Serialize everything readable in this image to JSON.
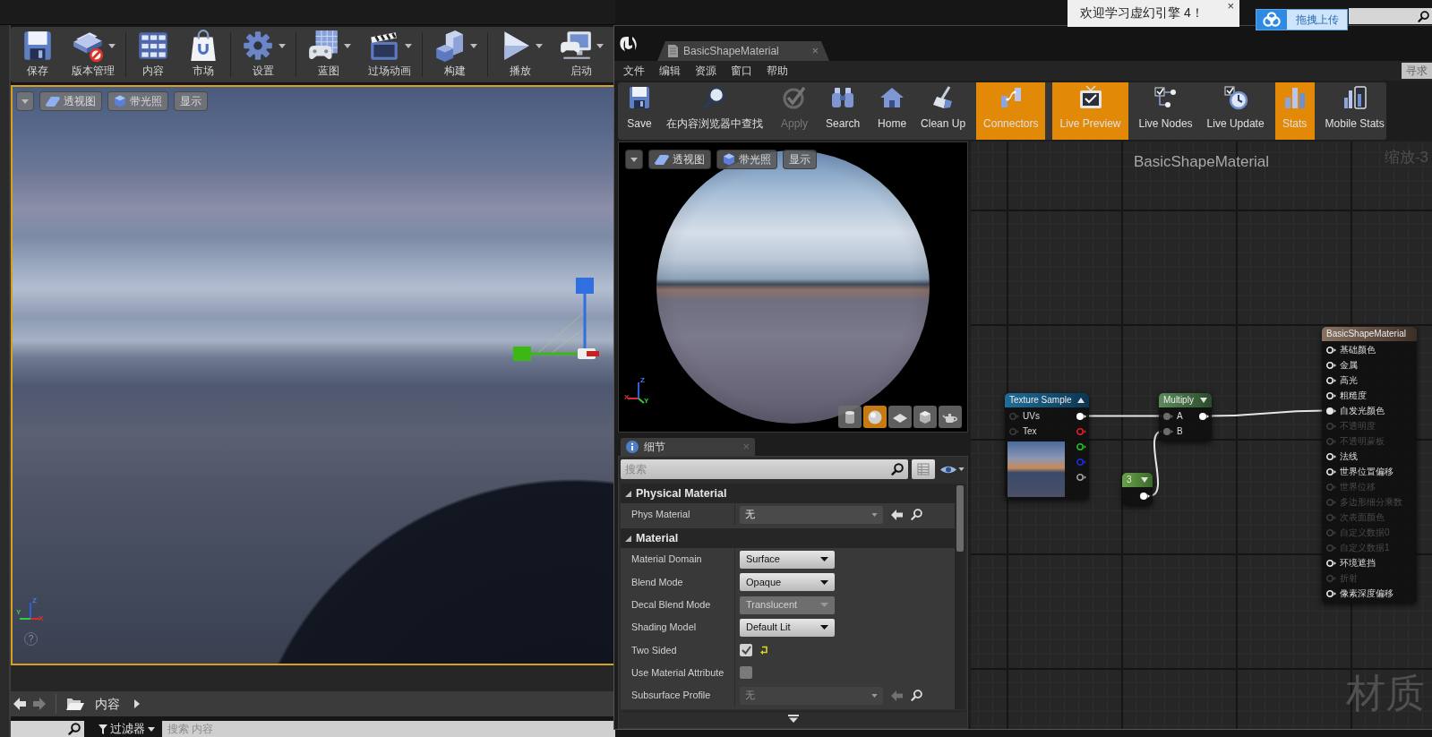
{
  "editor": {
    "toolbar": [
      {
        "label": "保存",
        "dropdown": false
      },
      {
        "label": "版本管理",
        "dropdown": true
      },
      {
        "label": "内容",
        "dropdown": false
      },
      {
        "label": "市场",
        "dropdown": false
      },
      {
        "label": "设置",
        "dropdown": true
      },
      {
        "label": "蓝图",
        "dropdown": true
      },
      {
        "label": "过场动画",
        "dropdown": true
      },
      {
        "label": "构建",
        "dropdown": true
      },
      {
        "label": "播放",
        "dropdown": true
      },
      {
        "label": "启动",
        "dropdown": true
      }
    ],
    "viewport": {
      "view_mode": "透视图",
      "lighting": "带光照",
      "show": "显示",
      "axes": [
        "Z",
        "Y",
        "X"
      ],
      "help": "?"
    }
  },
  "content_browser": {
    "path": "内容",
    "filter": "过滤器",
    "search": {
      "placeholder": "搜索 内容"
    }
  },
  "notification": {
    "text": "欢迎学习虚幻引擎 4！",
    "close": "×"
  },
  "upload_button": {
    "label": "拖拽上传"
  },
  "material_editor": {
    "tab": {
      "title": "BasicShapeMaterial",
      "close": "×"
    },
    "menu": [
      "文件",
      "编辑",
      "资源",
      "窗口",
      "帮助"
    ],
    "help_search": {
      "placeholder": "寻求"
    },
    "toolbar": [
      {
        "label": "Save",
        "on": false,
        "disabled": false
      },
      {
        "label": "在内容浏览器中查找",
        "on": false,
        "disabled": false
      },
      {
        "label": "Apply",
        "on": false,
        "disabled": true
      },
      {
        "label": "Search",
        "on": false,
        "disabled": false
      },
      {
        "label": "Home",
        "on": false,
        "disabled": false
      },
      {
        "label": "Clean Up",
        "on": false,
        "disabled": false
      },
      {
        "label": "Connectors",
        "on": true,
        "disabled": false
      },
      {
        "label": "Live Preview",
        "on": true,
        "disabled": false
      },
      {
        "label": "Live Nodes",
        "on": false,
        "disabled": false
      },
      {
        "label": "Live Update",
        "on": false,
        "disabled": false
      },
      {
        "label": "Stats",
        "on": true,
        "disabled": false
      },
      {
        "label": "Mobile Stats",
        "on": false,
        "disabled": false
      }
    ],
    "preview": {
      "view_mode": "透视图",
      "lighting": "带光照",
      "show": "显示",
      "axes": [
        "Z",
        "X",
        "Y"
      ],
      "shapes": [
        {
          "selected": false
        },
        {
          "selected": true
        },
        {
          "selected": false
        },
        {
          "selected": false
        },
        {
          "selected": false
        }
      ]
    },
    "details": {
      "tab": "细节",
      "close": "×",
      "search": {
        "placeholder": "搜索"
      },
      "sections": [
        {
          "title": "Physical Material",
          "expanded": true,
          "rows": [
            {
              "kind": "asset",
              "label": "Phys Material",
              "value": "无",
              "disabled": false
            }
          ]
        },
        {
          "title": "Material",
          "expanded": true,
          "rows": [
            {
              "kind": "combo",
              "label": "Material Domain",
              "value": "Surface",
              "disabled": false
            },
            {
              "kind": "combo",
              "label": "Blend Mode",
              "value": "Opaque",
              "disabled": false
            },
            {
              "kind": "combo",
              "label": "Decal Blend Mode",
              "value": "Translucent",
              "disabled": true
            },
            {
              "kind": "combo",
              "label": "Shading Model",
              "value": "Default Lit",
              "disabled": false
            },
            {
              "kind": "checkbox",
              "label": "Two Sided",
              "checked": true,
              "modified": true
            },
            {
              "kind": "checkbox",
              "label": "Use Material Attribute",
              "checked": false,
              "modified": false
            },
            {
              "kind": "asset",
              "label": "Subsurface Profile",
              "value": "无",
              "disabled": true
            }
          ]
        }
      ]
    },
    "graph": {
      "title": "BasicShapeMaterial",
      "zoom": "缩放-3",
      "type_label": "材质",
      "nodes": [
        {
          "kind": "texture_sample",
          "title": "Texture Sample",
          "inputs": [
            {
              "label": "UVs",
              "connected": false
            },
            {
              "label": "Tex",
              "connected": false
            }
          ],
          "outputs": [
            {
              "color": "#ffffff",
              "connected": true
            },
            {
              "color": "#e02020",
              "connected": false
            },
            {
              "color": "#20c020",
              "connected": false
            },
            {
              "color": "#1c2ce0",
              "connected": false
            },
            {
              "color": "#a0a0a0",
              "connected": false
            }
          ]
        },
        {
          "kind": "multiply",
          "title": "Multiply",
          "inputs": [
            {
              "label": "A",
              "connected": true
            },
            {
              "label": "B",
              "connected": true
            }
          ],
          "outputs": [
            {
              "color": "#ffffff",
              "connected": true
            }
          ]
        },
        {
          "kind": "constant",
          "title": "3",
          "outputs": [
            {
              "color": "#ffffff",
              "connected": true
            }
          ]
        },
        {
          "kind": "result",
          "title": "BasicShapeMaterial",
          "inputs": [
            {
              "label": "基础颜色",
              "enabled": true,
              "connected": false
            },
            {
              "label": "金属",
              "enabled": true,
              "connected": false
            },
            {
              "label": "高光",
              "enabled": true,
              "connected": false
            },
            {
              "label": "粗糙度",
              "enabled": true,
              "connected": false
            },
            {
              "label": "自发光颜色",
              "enabled": true,
              "connected": true
            },
            {
              "label": "不透明度",
              "enabled": false,
              "connected": false
            },
            {
              "label": "不透明蒙板",
              "enabled": false,
              "connected": false
            },
            {
              "label": "法线",
              "enabled": true,
              "connected": false
            },
            {
              "label": "世界位置偏移",
              "enabled": true,
              "connected": false
            },
            {
              "label": "世界位移",
              "enabled": false,
              "connected": false
            },
            {
              "label": "多边形细分乘数",
              "enabled": false,
              "connected": false
            },
            {
              "label": "次表面颜色",
              "enabled": false,
              "connected": false
            },
            {
              "label": "自定义数据0",
              "enabled": false,
              "connected": false
            },
            {
              "label": "自定义数据1",
              "enabled": false,
              "connected": false
            },
            {
              "label": "环境遮挡",
              "enabled": true,
              "connected": false
            },
            {
              "label": "折射",
              "enabled": false,
              "connected": false
            },
            {
              "label": "像素深度偏移",
              "enabled": true,
              "connected": false
            }
          ]
        }
      ]
    }
  }
}
